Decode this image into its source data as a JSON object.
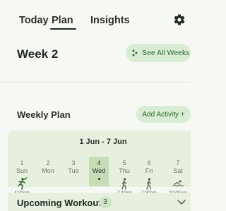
{
  "nav": {
    "tabs": [
      {
        "label": "Today"
      },
      {
        "label": "Plan",
        "active": true
      },
      {
        "label": "Insights"
      }
    ],
    "settings_icon": "gear-icon"
  },
  "week": {
    "title": "Week 2",
    "see_all_label": "See All Weeks"
  },
  "weekly_plan": {
    "title": "Weekly Plan",
    "add_activity_label": "Add Activity +"
  },
  "calendar": {
    "range": "1 Jun - 7 Jun",
    "selected_day": "4",
    "days": [
      {
        "num": "1",
        "name": "Sun",
        "time": "4:00pm",
        "icon": "run-done-icon"
      },
      {
        "num": "2",
        "name": "Mon",
        "time": "",
        "icon": ""
      },
      {
        "num": "3",
        "name": "Tue",
        "time": "",
        "icon": ""
      },
      {
        "num": "4",
        "name": "Wed",
        "time": "",
        "icon": ""
      },
      {
        "num": "5",
        "name": "Thu",
        "time": "7:30pm",
        "icon": "walk-icon"
      },
      {
        "num": "6",
        "name": "Fri",
        "time": "7:30pm",
        "icon": "walk-icon"
      },
      {
        "num": "7",
        "name": "Sat",
        "time": "10:00am",
        "icon": "swim-icon"
      }
    ]
  },
  "upcoming": {
    "title": "Upcoming Workouts",
    "count": "3"
  },
  "colors": {
    "accent": "#2f6a2f",
    "pill_bg": "#d9ecd4",
    "card_bg": "#e7efdf",
    "selected_day_bg": "#c6ddb8"
  }
}
